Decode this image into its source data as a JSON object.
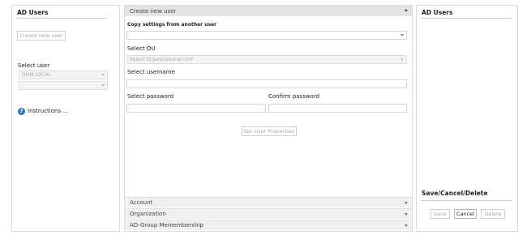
{
  "left_panel": {
    "title": "AD Users",
    "create_button": "Create new user",
    "select_user_label": "Select user",
    "domain_select_value": "DOM.LOCAL",
    "user_select_value": "",
    "instructions_label": "Instructions ..."
  },
  "center_panel": {
    "header_title": "Create new user",
    "copy_settings_label": "Copy settings from another user",
    "copy_settings_value": "",
    "select_ou_label": "Select OU",
    "select_ou_placeholder": "Select Organizational Unit",
    "select_username_label": "Select username",
    "select_password_label": "Select password",
    "confirm_password_label": "Confirm password",
    "set_properties_button": "Set User Properties",
    "sections": [
      {
        "label": "Account"
      },
      {
        "label": "Organization"
      },
      {
        "label": "AD-Group Memembership"
      }
    ]
  },
  "right_panel": {
    "title": "AD Users",
    "footer_title": "Save/Cancel/Delete",
    "save_button": "Save",
    "cancel_button": "Cancel",
    "delete_button": "Delete"
  },
  "colors": {
    "accent_help": "#2a7ac8",
    "border": "#dcdcdc",
    "header_bg": "#e3e3e3"
  }
}
